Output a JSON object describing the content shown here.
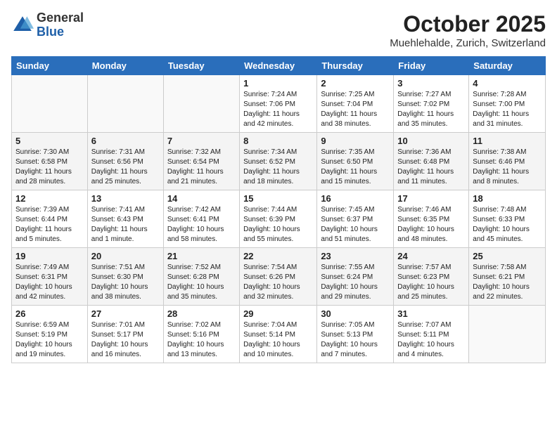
{
  "header": {
    "logo_general": "General",
    "logo_blue": "Blue",
    "month_title": "October 2025",
    "location": "Muehlehalde, Zurich, Switzerland"
  },
  "weekdays": [
    "Sunday",
    "Monday",
    "Tuesday",
    "Wednesday",
    "Thursday",
    "Friday",
    "Saturday"
  ],
  "weeks": [
    [
      {
        "day": "",
        "info": ""
      },
      {
        "day": "",
        "info": ""
      },
      {
        "day": "",
        "info": ""
      },
      {
        "day": "1",
        "info": "Sunrise: 7:24 AM\nSunset: 7:06 PM\nDaylight: 11 hours\nand 42 minutes."
      },
      {
        "day": "2",
        "info": "Sunrise: 7:25 AM\nSunset: 7:04 PM\nDaylight: 11 hours\nand 38 minutes."
      },
      {
        "day": "3",
        "info": "Sunrise: 7:27 AM\nSunset: 7:02 PM\nDaylight: 11 hours\nand 35 minutes."
      },
      {
        "day": "4",
        "info": "Sunrise: 7:28 AM\nSunset: 7:00 PM\nDaylight: 11 hours\nand 31 minutes."
      }
    ],
    [
      {
        "day": "5",
        "info": "Sunrise: 7:30 AM\nSunset: 6:58 PM\nDaylight: 11 hours\nand 28 minutes."
      },
      {
        "day": "6",
        "info": "Sunrise: 7:31 AM\nSunset: 6:56 PM\nDaylight: 11 hours\nand 25 minutes."
      },
      {
        "day": "7",
        "info": "Sunrise: 7:32 AM\nSunset: 6:54 PM\nDaylight: 11 hours\nand 21 minutes."
      },
      {
        "day": "8",
        "info": "Sunrise: 7:34 AM\nSunset: 6:52 PM\nDaylight: 11 hours\nand 18 minutes."
      },
      {
        "day": "9",
        "info": "Sunrise: 7:35 AM\nSunset: 6:50 PM\nDaylight: 11 hours\nand 15 minutes."
      },
      {
        "day": "10",
        "info": "Sunrise: 7:36 AM\nSunset: 6:48 PM\nDaylight: 11 hours\nand 11 minutes."
      },
      {
        "day": "11",
        "info": "Sunrise: 7:38 AM\nSunset: 6:46 PM\nDaylight: 11 hours\nand 8 minutes."
      }
    ],
    [
      {
        "day": "12",
        "info": "Sunrise: 7:39 AM\nSunset: 6:44 PM\nDaylight: 11 hours\nand 5 minutes."
      },
      {
        "day": "13",
        "info": "Sunrise: 7:41 AM\nSunset: 6:43 PM\nDaylight: 11 hours\nand 1 minute."
      },
      {
        "day": "14",
        "info": "Sunrise: 7:42 AM\nSunset: 6:41 PM\nDaylight: 10 hours\nand 58 minutes."
      },
      {
        "day": "15",
        "info": "Sunrise: 7:44 AM\nSunset: 6:39 PM\nDaylight: 10 hours\nand 55 minutes."
      },
      {
        "day": "16",
        "info": "Sunrise: 7:45 AM\nSunset: 6:37 PM\nDaylight: 10 hours\nand 51 minutes."
      },
      {
        "day": "17",
        "info": "Sunrise: 7:46 AM\nSunset: 6:35 PM\nDaylight: 10 hours\nand 48 minutes."
      },
      {
        "day": "18",
        "info": "Sunrise: 7:48 AM\nSunset: 6:33 PM\nDaylight: 10 hours\nand 45 minutes."
      }
    ],
    [
      {
        "day": "19",
        "info": "Sunrise: 7:49 AM\nSunset: 6:31 PM\nDaylight: 10 hours\nand 42 minutes."
      },
      {
        "day": "20",
        "info": "Sunrise: 7:51 AM\nSunset: 6:30 PM\nDaylight: 10 hours\nand 38 minutes."
      },
      {
        "day": "21",
        "info": "Sunrise: 7:52 AM\nSunset: 6:28 PM\nDaylight: 10 hours\nand 35 minutes."
      },
      {
        "day": "22",
        "info": "Sunrise: 7:54 AM\nSunset: 6:26 PM\nDaylight: 10 hours\nand 32 minutes."
      },
      {
        "day": "23",
        "info": "Sunrise: 7:55 AM\nSunset: 6:24 PM\nDaylight: 10 hours\nand 29 minutes."
      },
      {
        "day": "24",
        "info": "Sunrise: 7:57 AM\nSunset: 6:23 PM\nDaylight: 10 hours\nand 25 minutes."
      },
      {
        "day": "25",
        "info": "Sunrise: 7:58 AM\nSunset: 6:21 PM\nDaylight: 10 hours\nand 22 minutes."
      }
    ],
    [
      {
        "day": "26",
        "info": "Sunrise: 6:59 AM\nSunset: 5:19 PM\nDaylight: 10 hours\nand 19 minutes."
      },
      {
        "day": "27",
        "info": "Sunrise: 7:01 AM\nSunset: 5:17 PM\nDaylight: 10 hours\nand 16 minutes."
      },
      {
        "day": "28",
        "info": "Sunrise: 7:02 AM\nSunset: 5:16 PM\nDaylight: 10 hours\nand 13 minutes."
      },
      {
        "day": "29",
        "info": "Sunrise: 7:04 AM\nSunset: 5:14 PM\nDaylight: 10 hours\nand 10 minutes."
      },
      {
        "day": "30",
        "info": "Sunrise: 7:05 AM\nSunset: 5:13 PM\nDaylight: 10 hours\nand 7 minutes."
      },
      {
        "day": "31",
        "info": "Sunrise: 7:07 AM\nSunset: 5:11 PM\nDaylight: 10 hours\nand 4 minutes."
      },
      {
        "day": "",
        "info": ""
      }
    ]
  ]
}
